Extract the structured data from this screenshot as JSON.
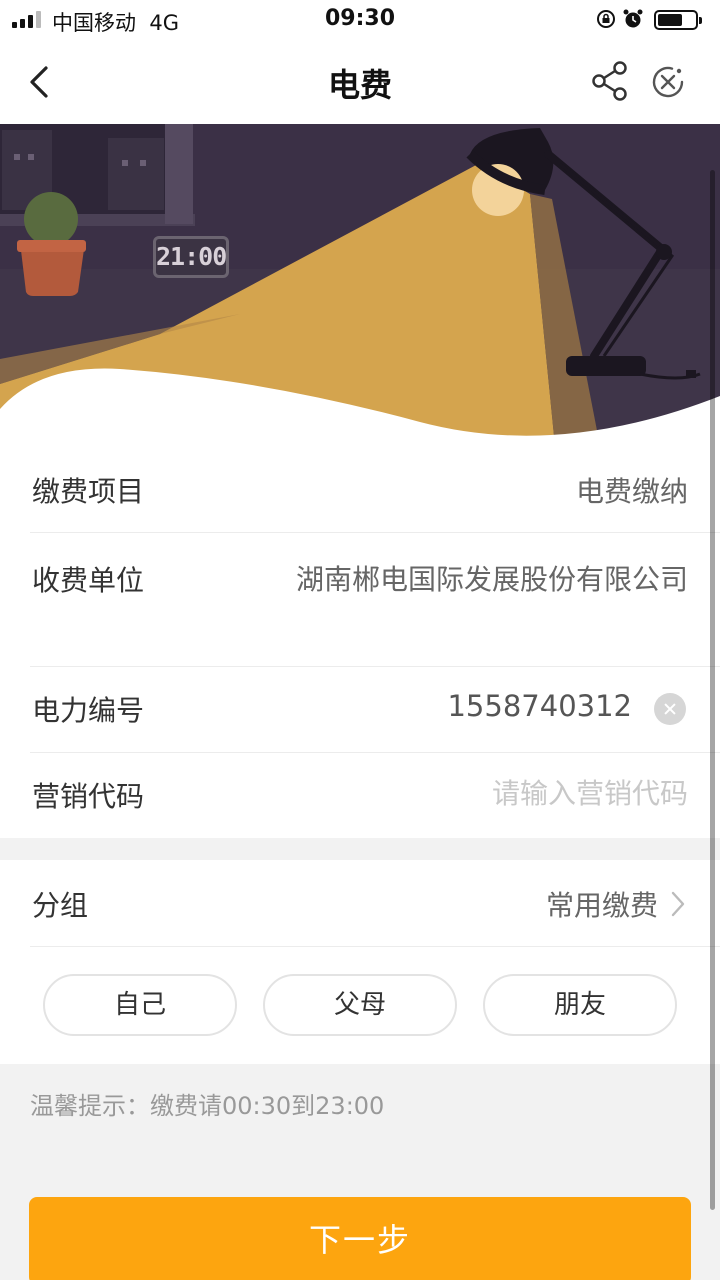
{
  "status_bar": {
    "carrier": "中国移动",
    "network": "4G",
    "time": "09:30",
    "icons": [
      "signal-icon",
      "orientation-lock-icon",
      "alarm-icon",
      "battery-icon"
    ]
  },
  "nav": {
    "title": "电费",
    "back_icon": "back-arrow-icon",
    "share_icon": "share-icon",
    "close_icon": "close-icon"
  },
  "banner": {
    "clock_text": "21:00",
    "colors": {
      "night": "#3b3046",
      "light": "#d4a44e",
      "lamp": "#1b1620"
    }
  },
  "form": {
    "item": {
      "label": "缴费项目",
      "value": "电费缴纳"
    },
    "payee": {
      "label": "收费单位",
      "value": "湖南郴电国际发展股份有限公司"
    },
    "account": {
      "label": "电力编号",
      "value": "1558740312",
      "clear_icon": "clear-icon"
    },
    "marketing": {
      "label": "营销代码",
      "placeholder": "请输入营销代码",
      "value": ""
    }
  },
  "group": {
    "label": "分组",
    "value": "常用缴费",
    "chevron_icon": "chevron-right-icon",
    "chips": [
      "自己",
      "父母",
      "朋友"
    ]
  },
  "tip": "温馨提示：缴费请00:30到23:00",
  "next_button": "下一步",
  "colors": {
    "accent": "#fda50f",
    "background": "#f2f2f2"
  }
}
